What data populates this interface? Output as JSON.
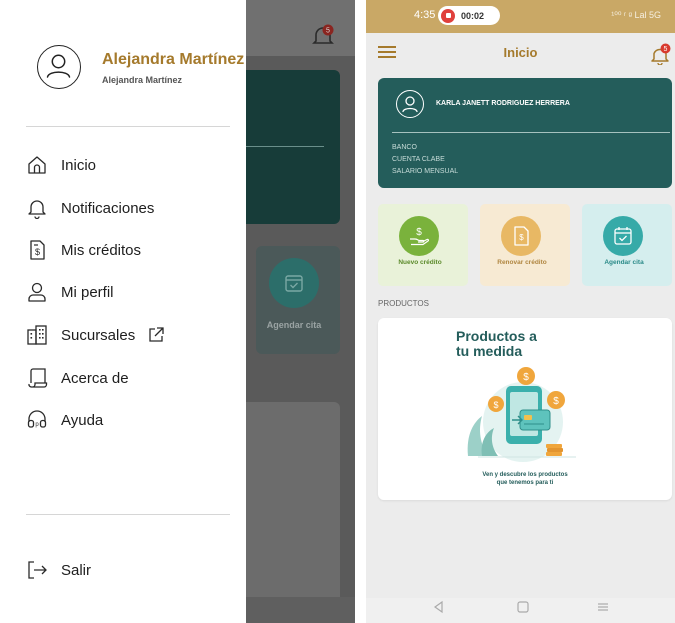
{
  "left_screen": {
    "drawer": {
      "user_name": "Alejandra Martínez",
      "user_subtitle": "Alejandra Martínez",
      "menu_items": [
        {
          "label": "Inicio",
          "icon": "home-icon"
        },
        {
          "label": "Notificaciones",
          "icon": "bell-icon"
        },
        {
          "label": "Mis créditos",
          "icon": "document-money-icon"
        },
        {
          "label": "Mi perfil",
          "icon": "person-icon"
        },
        {
          "label": "Sucursales",
          "icon": "building-icon",
          "extra_icon": "external-link-icon"
        },
        {
          "label": "Acerca de",
          "icon": "scroll-icon"
        },
        {
          "label": "Ayuda",
          "icon": "headset-icon"
        }
      ],
      "logout_label": "Salir"
    },
    "background": {
      "notification_count": "5",
      "service_label": "Agendar cita"
    }
  },
  "right_screen": {
    "status_bar": {
      "time": "4:35",
      "recording_time": "00:02",
      "system_indicators": "¹⁰⁰ ʳ ᵍ Lal 5G"
    },
    "app_bar": {
      "title": "Inicio",
      "notification_count": "5"
    },
    "account_card": {
      "name": "KARLA JANETT RODRIGUEZ HERRERA",
      "fields": [
        "BANCO",
        "CUENTA CLABE",
        "SALARIO MENSUAL"
      ]
    },
    "services": [
      {
        "label": "Nuevo crédito",
        "icon": "hand-money-icon",
        "color": "#7ab23c",
        "bg": "#e9f2d9",
        "text_color": "#5b8a2a"
      },
      {
        "label": "Renovar crédito",
        "icon": "renew-credit-icon",
        "color": "#e8b864",
        "bg": "#f7ead3",
        "text_color": "#b08641"
      },
      {
        "label": "Agendar cita",
        "icon": "calendar-icon",
        "color": "#36aaa8",
        "bg": "#d5eeee",
        "text_color": "#2a8a88"
      }
    ],
    "products": {
      "section_label": "PRODUCTOS",
      "card_title_line1": "Productos a",
      "card_title_line2": "tu medida",
      "card_text_line1": "Ven y descubre los productos",
      "card_text_line2": "que tenemos para ti"
    },
    "system_nav": [
      "back-icon",
      "home-icon",
      "recents-icon"
    ]
  },
  "colors": {
    "accent_gold": "#a57a2c",
    "status_gold": "#c9a866",
    "teal_dark": "#245d5b",
    "badge_red": "#d83a2e"
  }
}
